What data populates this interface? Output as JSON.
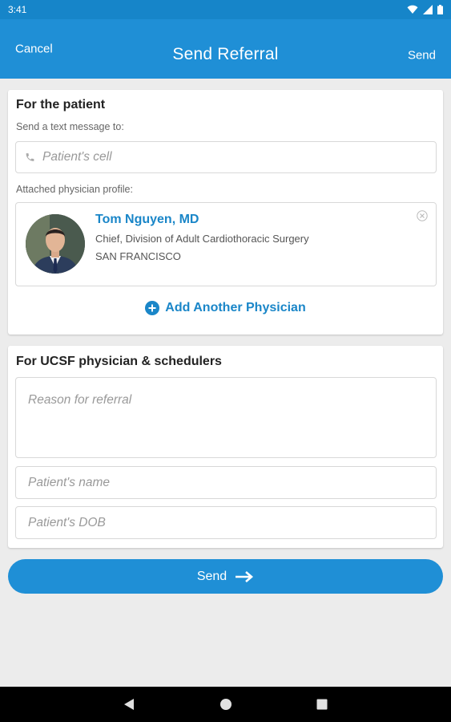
{
  "status_bar": {
    "time": "3:41"
  },
  "header": {
    "cancel_label": "Cancel",
    "title": "Send Referral",
    "send_label": "Send"
  },
  "patient_section": {
    "title": "For the patient",
    "text_label": "Send a text message to:",
    "cell_placeholder": "Patient's cell",
    "attached_label": "Attached physician profile:",
    "physician": {
      "name": "Tom Nguyen, MD",
      "title": "Chief, Division of Adult Cardiothoracic Surgery",
      "location": "SAN FRANCISCO"
    },
    "add_physician_label": "Add Another Physician"
  },
  "ucsf_section": {
    "title": "For UCSF physician & schedulers",
    "reason_placeholder": "Reason for referral",
    "name_placeholder": "Patient's name",
    "dob_placeholder": "Patient's DOB"
  },
  "send_button_label": "Send",
  "colors": {
    "primary": "#1f8fd6",
    "link": "#1a86c8",
    "background": "#ececec"
  },
  "icons": [
    "wifi-icon",
    "signal-icon",
    "battery-icon",
    "phone-icon",
    "close-circle-icon",
    "plus-circle-icon",
    "arrow-right-icon",
    "back-icon",
    "home-icon",
    "recents-icon"
  ]
}
